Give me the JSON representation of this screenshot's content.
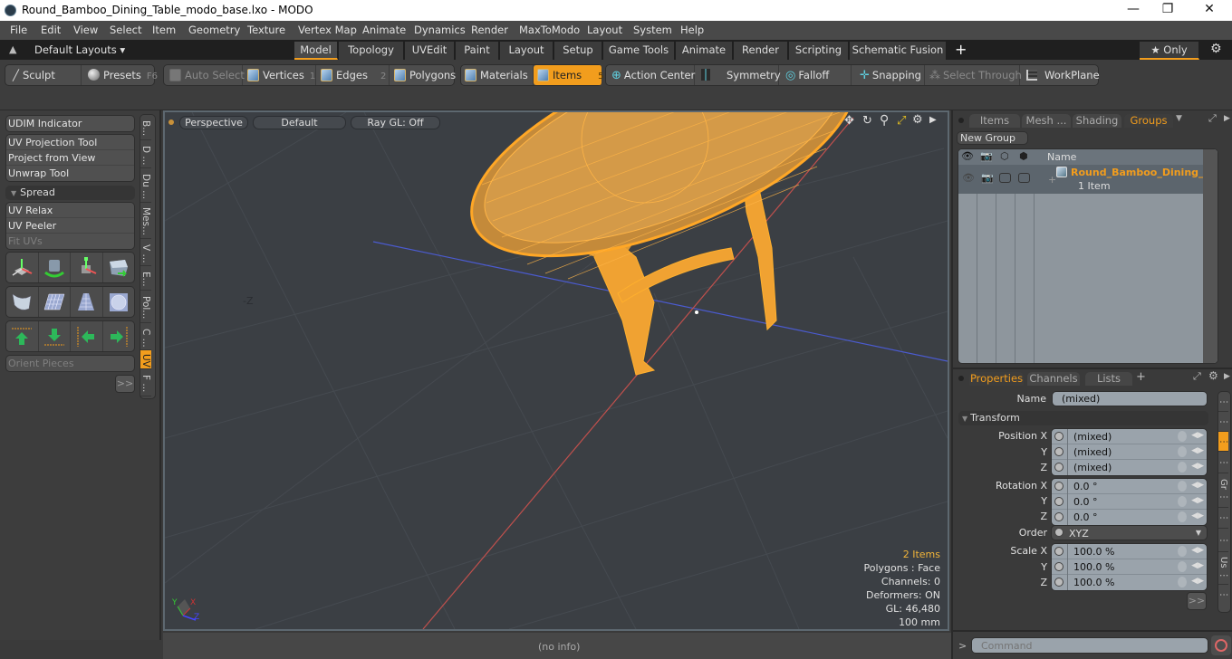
{
  "window": {
    "title": "Round_Bamboo_Dining_Table_modo_base.lxo - MODO",
    "minimize": "—",
    "maximize": "❐",
    "close": "✕"
  },
  "menu": [
    "File",
    "Edit",
    "View",
    "Select",
    "Item",
    "Geometry",
    "Texture",
    "Vertex Map",
    "Animate",
    "Dynamics",
    "Render",
    "MaxToModo",
    "Layout",
    "System",
    "Help"
  ],
  "layoutbar": {
    "layouts_label": "Default Layouts ▾",
    "tabs": [
      "Model",
      "Topology",
      "UVEdit",
      "Paint",
      "Layout",
      "Setup",
      "Game Tools",
      "Animate",
      "Render",
      "Scripting",
      "Schematic Fusion"
    ],
    "active_tab": "Model",
    "add": "+",
    "only_label": "★ Only"
  },
  "toolbar": {
    "sculpt": "Sculpt",
    "presets": "Presets",
    "presets_key": "F6",
    "auto_select": "Auto Select",
    "vertices": "Vertices",
    "vertices_key": "1",
    "edges": "Edges",
    "edges_key": "2",
    "polygons": "Polygons",
    "materials": "Materials",
    "items": "Items",
    "items_key": "5",
    "action_center": "Action Center",
    "symmetry": "Symmetry",
    "falloff": "Falloff",
    "snapping": "Snapping",
    "select_through": "Select Through",
    "workplane": "WorkPlane"
  },
  "leftpanel": {
    "udim": "UDIM Indicator",
    "group1": [
      "UV Projection Tool",
      "Project from View",
      "Unwrap Tool"
    ],
    "spread": "Spread",
    "group2": [
      "UV Relax",
      "UV Peeler",
      "Fit UVs"
    ],
    "orient": "Orient Pieces",
    "more": ">>",
    "vtabs": [
      "B...",
      "D ...",
      "Du ...",
      "Mes...",
      "V ...",
      "E...",
      "Pol...",
      "C ...",
      "UV",
      "F ..."
    ],
    "active_vtab": "UV"
  },
  "viewport": {
    "view": "Perspective",
    "shading": "Default",
    "raygl": "Ray GL: Off",
    "axis_label": "-Z",
    "stats": {
      "items": "2 Items",
      "polygons": "Polygons : Face",
      "channels": "Channels: 0",
      "deformers": "Deformers: ON",
      "gl": "GL: 46,480",
      "scale": "100 mm"
    },
    "gizmo": {
      "x": "X",
      "y": "Y",
      "z": "Z"
    }
  },
  "statusbar": {
    "info": "(no info)"
  },
  "groups_panel": {
    "tabs": [
      "Items",
      "Mesh ...",
      "Shading",
      "Groups"
    ],
    "active_tab": "Groups",
    "new_group": "New Group",
    "name_header": "Name",
    "rows": [
      {
        "name": "Round_Bamboo_Dining_T...",
        "sub": "1 Item"
      }
    ]
  },
  "properties_panel": {
    "tabs": [
      "Properties",
      "Channels",
      "Lists"
    ],
    "active_tab": "Properties",
    "add": "+",
    "name_label": "Name",
    "name_value": "(mixed)",
    "transform": "Transform",
    "position": [
      {
        "label": "Position X",
        "value": "(mixed)"
      },
      {
        "label": "Y",
        "value": "(mixed)"
      },
      {
        "label": "Z",
        "value": "(mixed)"
      }
    ],
    "rotation": [
      {
        "label": "Rotation X",
        "value": "0.0 °"
      },
      {
        "label": "Y",
        "value": "0.0 °"
      },
      {
        "label": "Z",
        "value": "0.0 °"
      }
    ],
    "order_label": "Order",
    "order_value": "XYZ",
    "scale": [
      {
        "label": "Scale X",
        "value": "100.0 %"
      },
      {
        "label": "Y",
        "value": "100.0 %"
      },
      {
        "label": "Z",
        "value": "100.0 %"
      }
    ],
    "more": ">>",
    "side_tabs": [
      "⋮",
      "⋮",
      "⋮",
      "⋮",
      "Gr ⋮",
      "⋮",
      "⋮",
      "Us ⋮",
      "⋮"
    ]
  },
  "command": {
    "prompt": ">",
    "placeholder": "Command"
  },
  "colors": {
    "accent": "#f29d1d",
    "selection": "#ffa726",
    "x_axis": "#c0504d",
    "z_axis": "#4a5ec4"
  }
}
